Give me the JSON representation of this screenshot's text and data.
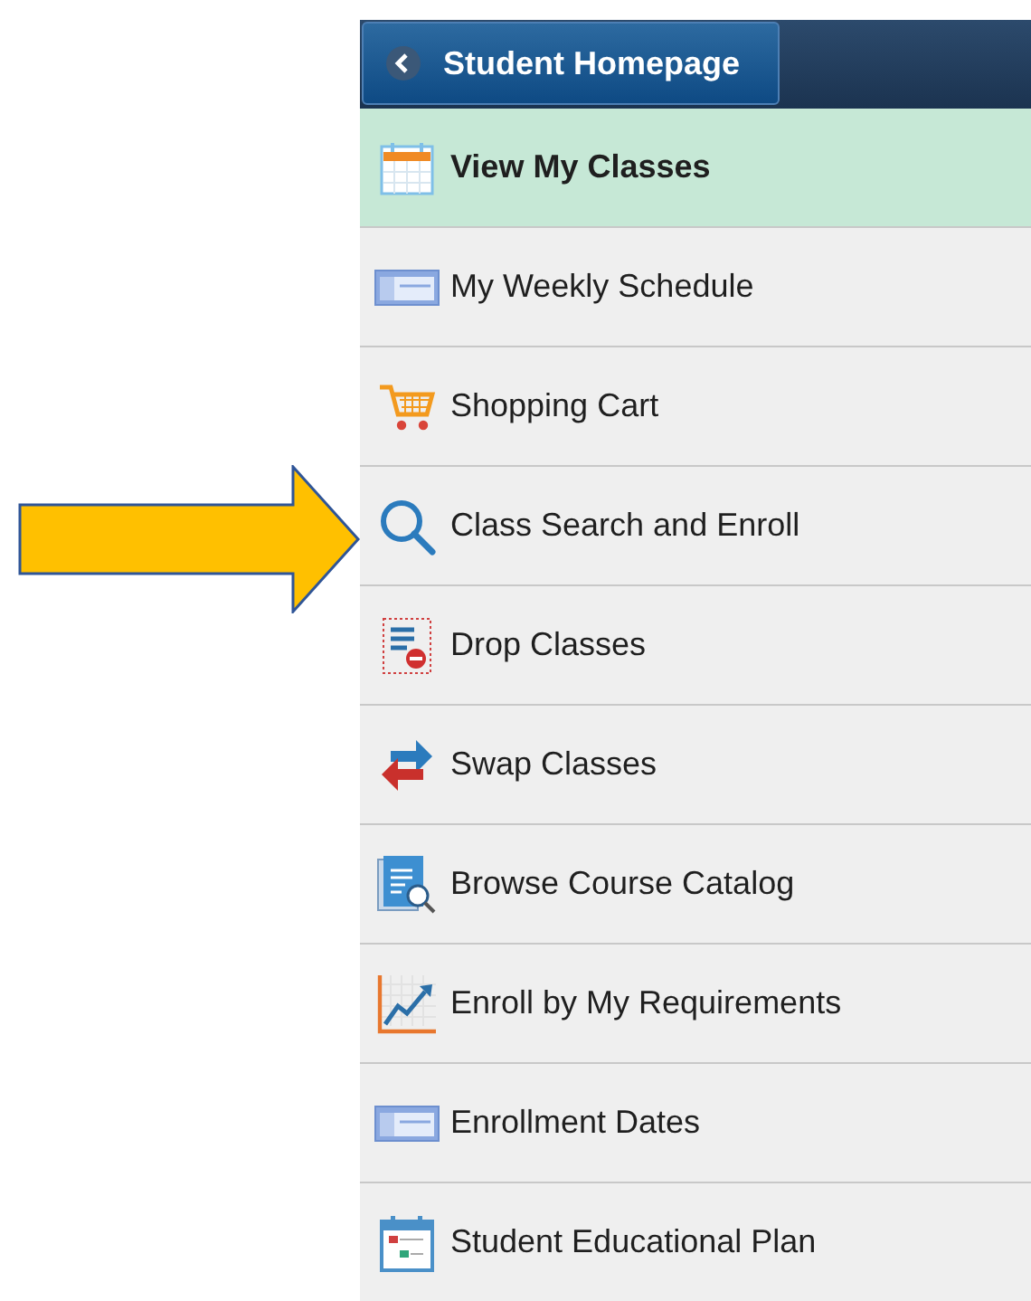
{
  "header": {
    "back_button": "Student Homepage"
  },
  "menu": [
    {
      "label": "View My Classes",
      "selected": true
    },
    {
      "label": "My Weekly Schedule",
      "selected": false
    },
    {
      "label": "Shopping Cart",
      "selected": false
    },
    {
      "label": "Class Search and Enroll",
      "selected": false
    },
    {
      "label": "Drop Classes",
      "selected": false
    },
    {
      "label": "Swap Classes",
      "selected": false
    },
    {
      "label": "Browse Course Catalog",
      "selected": false
    },
    {
      "label": "Enroll by My Requirements",
      "selected": false
    },
    {
      "label": "Enrollment Dates",
      "selected": false
    },
    {
      "label": "Student Educational Plan",
      "selected": false
    }
  ]
}
